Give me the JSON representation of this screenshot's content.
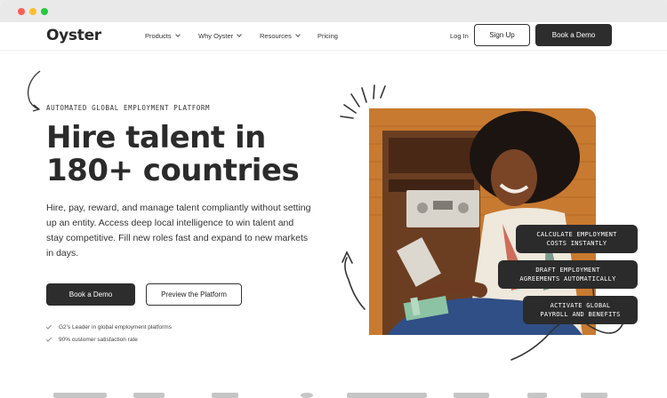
{
  "window": {
    "controls": [
      "close",
      "minimize",
      "maximize"
    ]
  },
  "nav": {
    "logo": "Oyster",
    "menu": [
      {
        "label": "Products",
        "has_dropdown": true
      },
      {
        "label": "Why Oyster",
        "has_dropdown": true
      },
      {
        "label": "Resources",
        "has_dropdown": true
      },
      {
        "label": "Pricing",
        "has_dropdown": false
      }
    ],
    "login": "Log In",
    "signup": "Sign Up",
    "book_demo": "Book a Demo"
  },
  "hero": {
    "eyebrow": "AUTOMATED GLOBAL EMPLOYMENT PLATFORM",
    "headline_bold_1": "Hire",
    "headline_rest_1": " talent in",
    "headline_line_2": "180+ countries",
    "subtext": "Hire, pay, reward, and manage talent compliantly without setting up an entity. Access deep local intelligence to win talent and stay competitive. Fill new roles fast and expand to new markets in days.",
    "cta_primary": "Book a Demo",
    "cta_secondary": "Preview the Platform",
    "checks": [
      "G2's Leader in global employment platforms",
      "90% customer satisfaction rate"
    ]
  },
  "feature_pills": [
    {
      "line1": "CALCULATE EMPLOYMENT",
      "line2": "COSTS INSTANTLY"
    },
    {
      "line1": "DRAFT EMPLOYMENT",
      "line2": "AGREEMENTS AUTOMATICALLY"
    },
    {
      "line1": "ACTIVATE GLOBAL",
      "line2": "PAYROLL AND BENEFITS"
    }
  ],
  "colors": {
    "dark_button": "#2d2d2d",
    "photo_background": "#c9792e",
    "pill_background": "#2b2b2b"
  }
}
